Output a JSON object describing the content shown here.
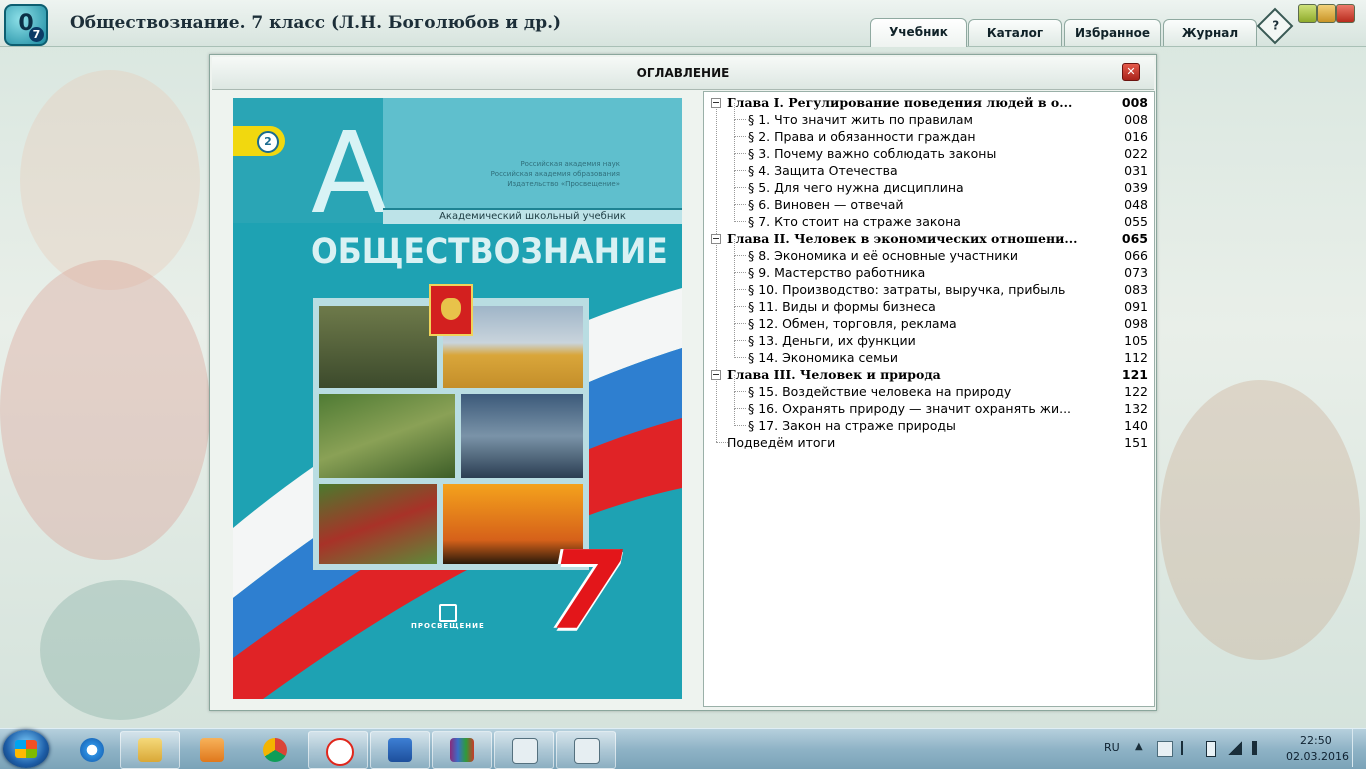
{
  "window": {
    "title": "Обществознание. 7 класс (Л.Н. Боголюбов и др.)",
    "logo_digit": "0",
    "logo_sub": "7",
    "tabs": [
      {
        "label": "Учебник",
        "active": true
      },
      {
        "label": "Каталог",
        "active": false
      },
      {
        "label": "Избранное",
        "active": false
      },
      {
        "label": "Журнал",
        "active": false
      }
    ],
    "help_label": "?"
  },
  "toc": {
    "header": "ОГЛАВЛЕНИЕ",
    "close_label": "✕",
    "items": [
      {
        "level": 0,
        "text": "Глава I. Регулирование поведения людей в о...",
        "page": "008"
      },
      {
        "level": 1,
        "text": "§ 1. Что значит жить по правилам",
        "page": "008"
      },
      {
        "level": 1,
        "text": "§ 2. Права и обязанности граждан",
        "page": "016"
      },
      {
        "level": 1,
        "text": "§ 3. Почему важно соблюдать законы",
        "page": "022"
      },
      {
        "level": 1,
        "text": "§ 4. Защита Отечества",
        "page": "031"
      },
      {
        "level": 1,
        "text": "§ 5. Для чего нужна дисциплина",
        "page": "039"
      },
      {
        "level": 1,
        "text": "§ 6. Виновен — отвечай",
        "page": "048"
      },
      {
        "level": 1,
        "text": "§ 7. Кто стоит на страже закона",
        "page": "055"
      },
      {
        "level": 0,
        "text": "Глава II. Человек в экономических отношени...",
        "page": "065"
      },
      {
        "level": 1,
        "text": "§ 8. Экономика и её основные участники",
        "page": "066"
      },
      {
        "level": 1,
        "text": "§ 9. Мастерство работника",
        "page": "073"
      },
      {
        "level": 1,
        "text": "§ 10. Производство: затраты, выручка, прибыль",
        "page": "083"
      },
      {
        "level": 1,
        "text": "§ 11. Виды и формы бизнеса",
        "page": "091"
      },
      {
        "level": 1,
        "text": "§ 12. Обмен, торговля, реклама",
        "page": "098"
      },
      {
        "level": 1,
        "text": "§ 13. Деньги, их функции",
        "page": "105"
      },
      {
        "level": 1,
        "text": "§ 14. Экономика семьи",
        "page": "112"
      },
      {
        "level": 0,
        "text": "Глава III. Человек и природа",
        "page": "121"
      },
      {
        "level": 1,
        "text": "§ 15. Воздействие человека на природу",
        "page": "122"
      },
      {
        "level": 1,
        "text": "§ 16. Охранять природу — значит охранять жи...",
        "page": "132"
      },
      {
        "level": 1,
        "text": "§ 17. Закон на страже природы",
        "page": "140"
      },
      {
        "level": 2,
        "text": "Подведём итоги",
        "page": "151"
      }
    ]
  },
  "cover": {
    "letter": "А",
    "badge": "2",
    "publishers": [
      "Российская академия наук",
      "Российская академия образования",
      "Издательство «Просвещение»"
    ],
    "series": "Академический школьный учебник",
    "subject": "ОБЩЕСТВОЗНАНИЕ",
    "grade": "7",
    "publisher_name": "ПРОСВЕЩЕНИЕ"
  },
  "taskbar": {
    "apps": [
      "file-explorer-icon",
      "media-player-icon",
      "chrome-icon",
      "yandex-icon",
      "word-icon",
      "winrar-icon",
      "window-icon",
      "window-icon"
    ],
    "language": "RU",
    "time": "22:50",
    "date": "02.03.2016"
  },
  "colors": {
    "accent": "#1ea2b3",
    "title_bar": "#d7e4de",
    "flag_red": "#e3161a",
    "flag_blue": "#2e7fd0"
  }
}
